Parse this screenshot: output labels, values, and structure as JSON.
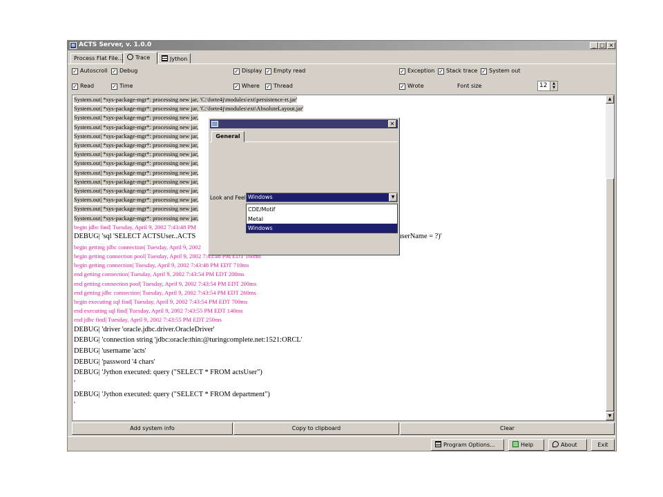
{
  "window": {
    "title": "ACTS Server, v. 1.0.0",
    "controls": {
      "minimize": "_",
      "maximize": "□",
      "close": "×"
    }
  },
  "tabs": [
    {
      "label": "Process Flat File..."
    },
    {
      "label": "Trace"
    },
    {
      "label": "Jython"
    }
  ],
  "options": {
    "autoscroll": {
      "label": "Autoscroll",
      "checked": true
    },
    "debug": {
      "label": "Debug",
      "checked": true
    },
    "display": {
      "label": "Display",
      "checked": true
    },
    "empty_read": {
      "label": "Empty read",
      "checked": true
    },
    "exception": {
      "label": "Exception",
      "checked": true
    },
    "stack_trace": {
      "label": "Stack trace",
      "checked": true
    },
    "system_out": {
      "label": "System out",
      "checked": true
    },
    "read": {
      "label": "Read",
      "checked": true
    },
    "time": {
      "label": "Time",
      "checked": true
    },
    "where": {
      "label": "Where",
      "checked": true
    },
    "thread": {
      "label": "Thread",
      "checked": true
    },
    "wrote": {
      "label": "Wrote",
      "checked": true
    },
    "font_size_label": "Font size",
    "font_size_value": "12"
  },
  "log": {
    "lines": [
      {
        "text": "System.out| *sys-package-mgr*: processing new jar, 'C:\\forte4j\\modules\\ext\\persistence-rt.jar'",
        "style": "sm hl"
      },
      {
        "text": "System.out| *sys-package-mgr*: processing new jar, 'C:\\forte4j\\modules\\ext\\AbsoluteLayout.jar'",
        "style": "sm hl"
      },
      {
        "text": "System.out| *sys-package-mgr*: processing new jar,",
        "style": "sm hl"
      },
      {
        "text": "System.out| *sys-package-mgr*: processing new jar,",
        "style": "sm hl"
      },
      {
        "text": "System.out| *sys-package-mgr*: processing new jar,",
        "style": "sm hl"
      },
      {
        "text": "System.out| *sys-package-mgr*: processing new jar,",
        "style": "sm hl"
      },
      {
        "text": "System.out| *sys-package-mgr*: processing new jar,",
        "style": "sm hl"
      },
      {
        "text": "System.out| *sys-package-mgr*: processing new jar,",
        "style": "sm hl"
      },
      {
        "text": "System.out| *sys-package-mgr*: processing new jar,",
        "style": "sm hl"
      },
      {
        "text": "System.out| *sys-package-mgr*: processing new jar,",
        "style": "sm hl"
      },
      {
        "text": "System.out| *sys-package-mgr*: processing new jar,",
        "style": "sm hl"
      },
      {
        "text": "System.out| *sys-package-mgr*: processing new jar,",
        "style": "sm hl"
      },
      {
        "text": "System.out| *sys-package-mgr*: processing new jar,",
        "style": "sm hl"
      },
      {
        "text": "System.out| *sys-package-mgr*: processing new jar,",
        "style": "sm hl"
      },
      {
        "text": "begin jdbc find| Tuesday, April 9, 2002 7:43:48 PM",
        "style": "sm pink"
      },
      {
        "text": "DEBUG| 'sql 'SELECT ACTSUser..ACTS",
        "style": "lg",
        "tail": "(userName = ?)'"
      },
      {
        "text": "begin getting jdbc connection| Tuesday, April 9, 2002",
        "style": "sm pink"
      },
      {
        "text": "begin getting connection pool| Tuesday, April 9, 2002 7:43:48 PM EDT 160ms",
        "style": "sm pink"
      },
      {
        "text": "begin getting connection| Tuesday, April 9, 2002 7:43:48 PM EDT 710ms",
        "style": "sm pink"
      },
      {
        "text": "end getting connection| Tuesday, April 9, 2002 7:43:54 PM EDT 200ms",
        "style": "sm pink"
      },
      {
        "text": "end getting connection pool| Tuesday, April 9, 2002 7:43:54 PM EDT 200ms",
        "style": "sm pink"
      },
      {
        "text": "end getting jdbc connection| Tuesday, April 9, 2002 7:43:54 PM EDT 260ms",
        "style": "sm pink"
      },
      {
        "text": "begin executing sql find| Tuesday, April 9, 2002 7:43:54 PM EDT 700ms",
        "style": "sm pink"
      },
      {
        "text": "end executing sql find| Tuesday, April 9, 2002 7:43:55 PM EDT 140ms",
        "style": "sm pink"
      },
      {
        "text": "end jdbc find| Tuesday, April 9, 2002 7:43:55 PM EDT 250ms",
        "style": "sm pink"
      },
      {
        "text": "DEBUG| 'driver 'oracle.jdbc.driver.OracleDriver'",
        "style": "lg"
      },
      {
        "text": "DEBUG| 'connection string 'jdbc:oracle:thin:@turingcomplete.net:1521:ORCL'",
        "style": "lg"
      },
      {
        "text": "DEBUG| 'username 'acts'",
        "style": "lg"
      },
      {
        "text": "DEBUG| 'password '4 chars'",
        "style": "lg"
      },
      {
        "text": "DEBUG| 'Jython executed: query (\"SELECT * FROM actsUser\")",
        "style": "lg"
      },
      {
        "text": "'",
        "style": "lg"
      },
      {
        "text": "DEBUG| 'Jython executed: query (\"SELECT * FROM department\")",
        "style": "lg"
      },
      {
        "text": "'",
        "style": "lg"
      }
    ]
  },
  "buttons": {
    "add_system_info": "Add system info",
    "copy_to_clipboard": "Copy to clipboard",
    "clear": "Clear"
  },
  "statusbar": {
    "program_options": "Program Options...",
    "help": "Help",
    "about": "About",
    "exit": "Exit"
  },
  "dialog": {
    "tab": "General",
    "look_and_feel_label": "Look and Feel",
    "selected": "Windows",
    "options": [
      "CDE/Motif",
      "Metal",
      "Windows"
    ]
  }
}
